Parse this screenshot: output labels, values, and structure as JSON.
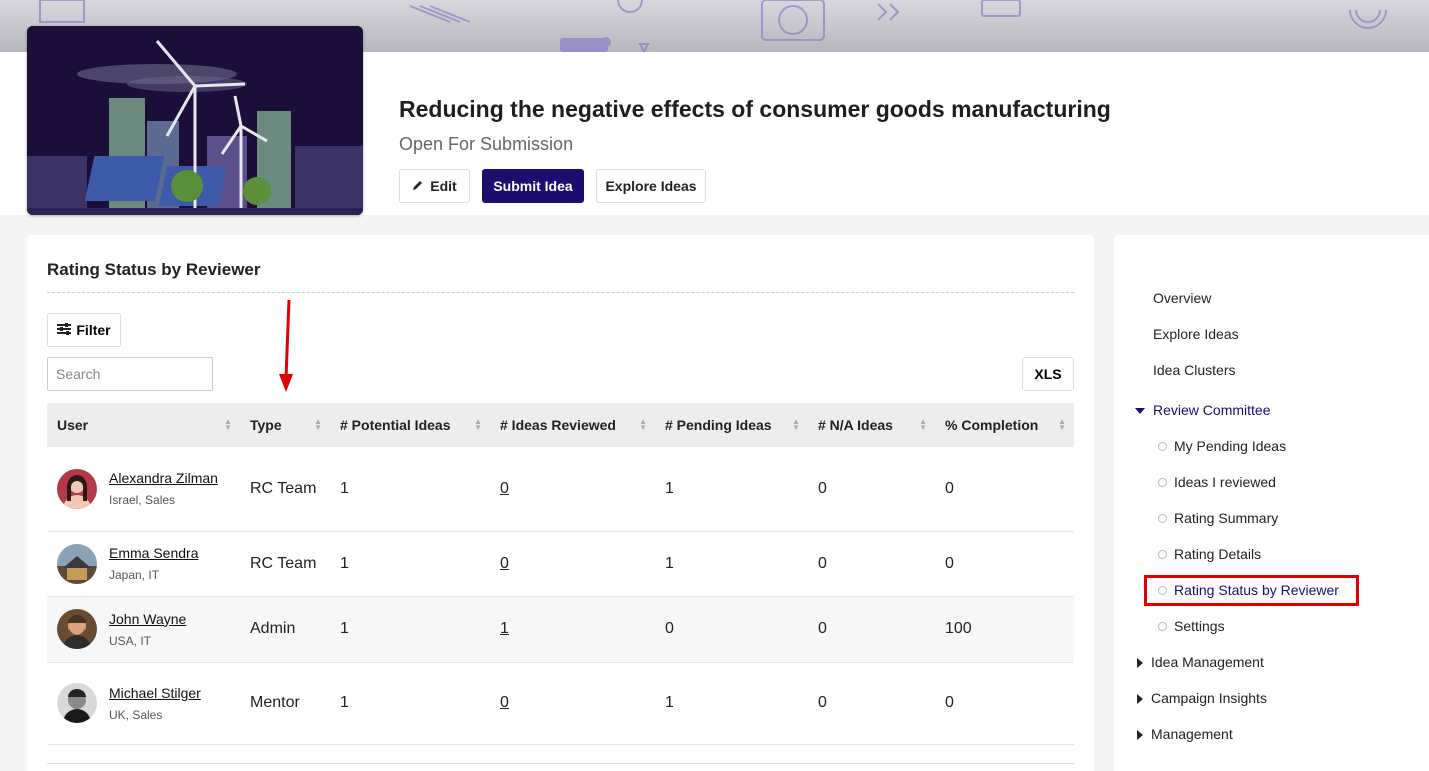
{
  "header": {
    "title": "Reducing the negative effects of consumer goods manufacturing",
    "status": "Open For Submission",
    "edit_label": "Edit",
    "submit_label": "Submit Idea",
    "explore_label": "Explore Ideas"
  },
  "panel": {
    "title": "Rating Status by Reviewer",
    "filter_label": "Filter",
    "search_placeholder": "Search",
    "xls_label": "XLS",
    "columns": [
      "User",
      "Type",
      "# Potential Ideas",
      "# Ideas Reviewed",
      "# Pending Ideas",
      "# N/A Ideas",
      "% Completion"
    ],
    "rows": [
      {
        "name": "Alexandra Zilman",
        "location": "Israel, Sales",
        "type": "RC Team",
        "potential": "1",
        "reviewed": "0",
        "pending": "1",
        "na": "0",
        "completion": "0",
        "avatar_color": "#b23a48"
      },
      {
        "name": "Emma Sendra",
        "location": "Japan, IT",
        "type": "RC Team",
        "potential": "1",
        "reviewed": "0",
        "pending": "1",
        "na": "0",
        "completion": "0",
        "avatar_color": "#7a6a4f"
      },
      {
        "name": "John Wayne",
        "location": "USA, IT",
        "type": "Admin",
        "potential": "1",
        "reviewed": "1",
        "pending": "0",
        "na": "0",
        "completion": "100",
        "avatar_color": "#8b5a3c"
      },
      {
        "name": "Michael Stilger",
        "location": "UK, Sales",
        "type": "Mentor",
        "potential": "1",
        "reviewed": "0",
        "pending": "1",
        "na": "0",
        "completion": "0",
        "avatar_color": "#3a3a3a"
      }
    ]
  },
  "sidebar": {
    "items": [
      {
        "label": "Overview"
      },
      {
        "label": "Explore Ideas"
      },
      {
        "label": "Idea Clusters"
      },
      {
        "label": "Review Committee"
      },
      {
        "label": "My Pending Ideas"
      },
      {
        "label": "Ideas I reviewed"
      },
      {
        "label": "Rating Summary"
      },
      {
        "label": "Rating Details"
      },
      {
        "label": "Rating Status by Reviewer"
      },
      {
        "label": "Settings"
      },
      {
        "label": "Idea Management"
      },
      {
        "label": "Campaign Insights"
      },
      {
        "label": "Management"
      }
    ]
  },
  "colors": {
    "brand": "#1e0c6e",
    "highlight": "#e00000",
    "arrow": "#e00000"
  }
}
